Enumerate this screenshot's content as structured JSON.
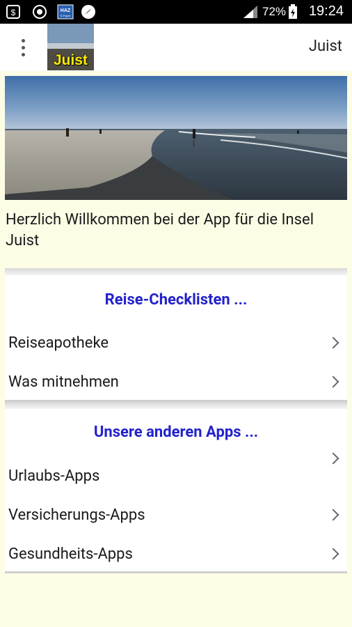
{
  "status_bar": {
    "battery": "72%",
    "time": "19:24"
  },
  "app_bar": {
    "logo_text": "Juist",
    "title": "Juist"
  },
  "welcome_text": "Herzlich Willkommen bei der App für die Insel Juist",
  "sections": [
    {
      "heading": "Reise-Checklisten ...",
      "items": [
        "Reiseapotheke",
        "Was mitnehmen"
      ]
    },
    {
      "heading": "Unsere anderen Apps ...",
      "items": [
        "Urlaubs-Apps",
        "Versicherungs-Apps",
        "Gesundheits-Apps"
      ]
    }
  ],
  "colors": {
    "background": "#fdfde6",
    "heading": "#2222cc",
    "status_bar": "#000000"
  }
}
